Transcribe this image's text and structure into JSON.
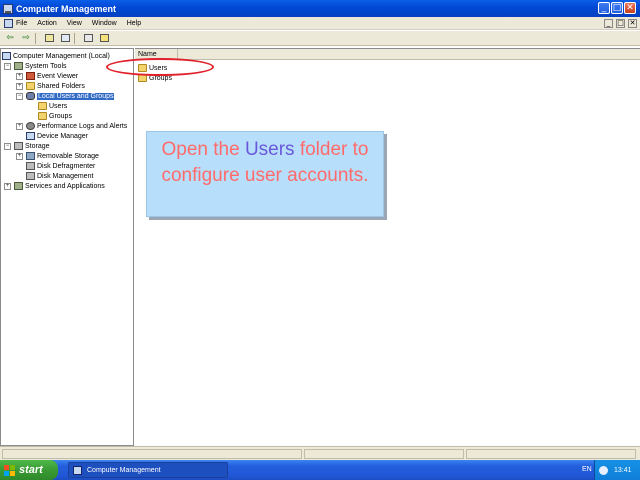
{
  "window": {
    "title": "Computer Management",
    "controls": [
      "_",
      "□",
      "✕"
    ]
  },
  "menu": {
    "items": [
      "File",
      "Action",
      "View",
      "Window",
      "Help"
    ],
    "child_controls": [
      "_",
      "□",
      "✕"
    ]
  },
  "toolbar": {
    "buttons": [
      "back-icon",
      "forward-icon",
      "up-folder-icon",
      "show-hide-tree-icon",
      "export-list-icon",
      "help-icon"
    ],
    "back_glyph": "⇦",
    "forward_glyph": "⇨"
  },
  "tree": {
    "root": "Computer Management (Local)",
    "system_tools": "System Tools",
    "event_viewer": "Event Viewer",
    "shared_folders": "Shared Folders",
    "local_users_groups": "Local Users and Groups",
    "users": "Users",
    "groups": "Groups",
    "perf_logs": "Performance Logs and Alerts",
    "device_manager": "Device Manager",
    "storage": "Storage",
    "removable_storage": "Removable Storage",
    "disk_defrag": "Disk Defragmenter",
    "disk_management": "Disk Management",
    "services_apps": "Services and Applications",
    "expand_minus": "−",
    "expand_plus": "+"
  },
  "list": {
    "column_name": "Name",
    "items": [
      "Users",
      "Groups"
    ]
  },
  "callout": {
    "part1": "Open the ",
    "accent": "Users",
    "part2": " folder to configure user accounts."
  },
  "taskbar": {
    "start_label": "start",
    "task_label": "Computer Management",
    "language": "EN",
    "clock": "13:41"
  },
  "colors": {
    "selection": "#316ac5",
    "callout_bg": "#b7defa",
    "callout_text": "#ff6b6b",
    "callout_accent": "#6a58dc",
    "highlight_ellipse": "#e0202a"
  }
}
